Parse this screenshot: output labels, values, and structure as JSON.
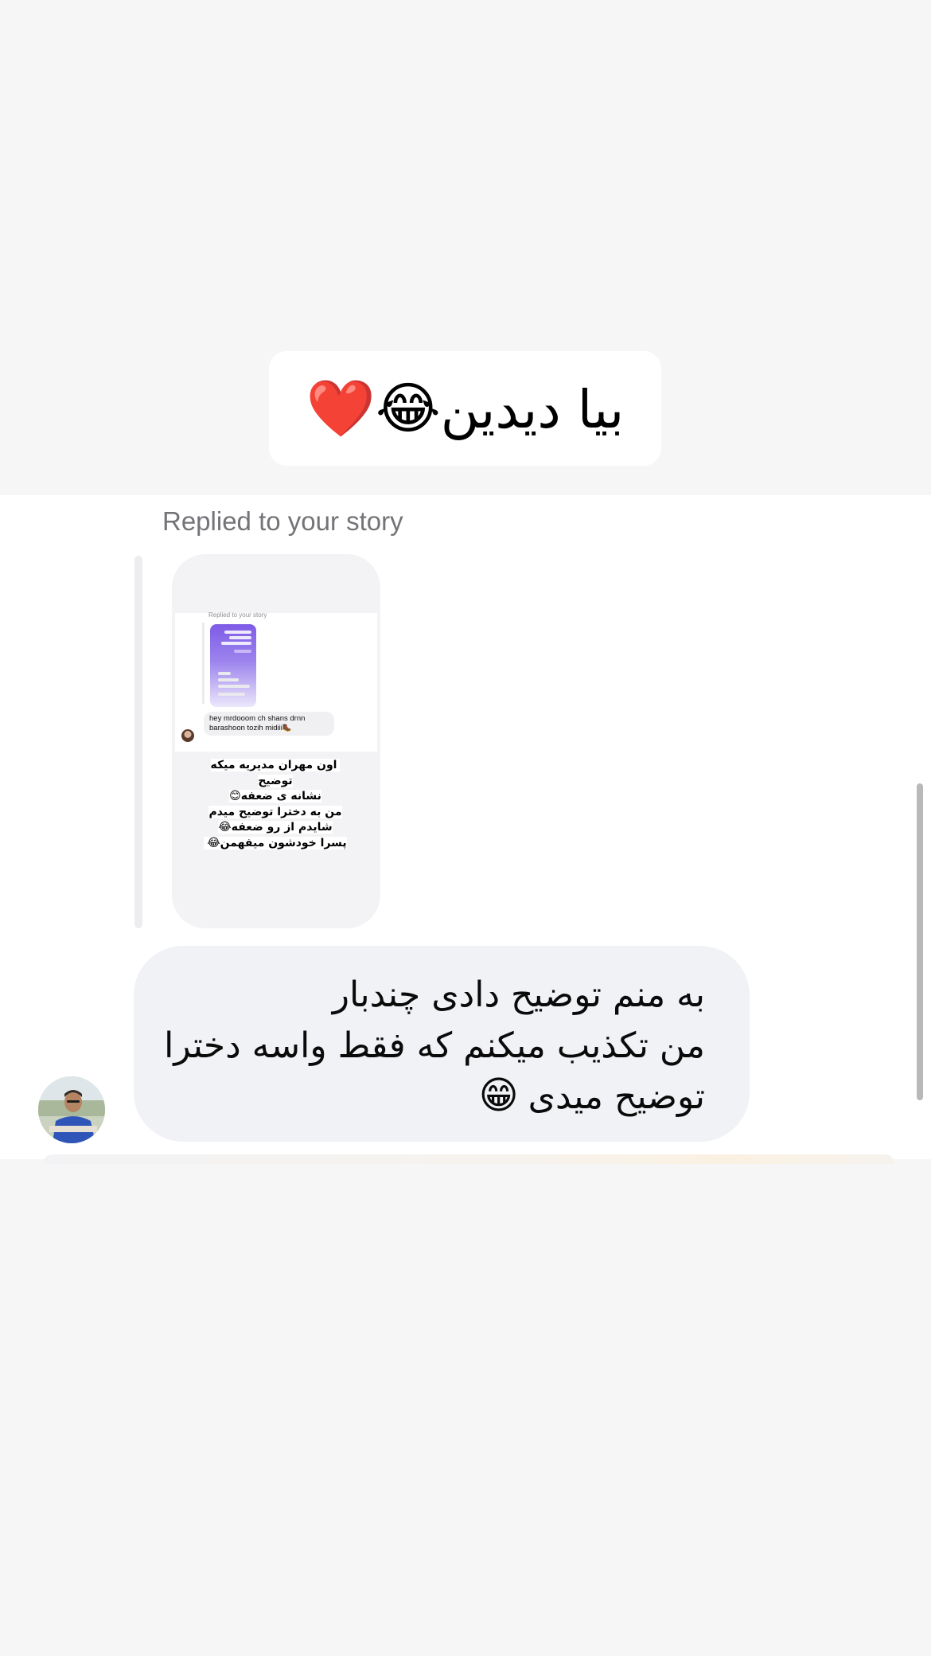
{
  "story_caption": {
    "text": "بیا دیدین",
    "emojis": [
      "😂",
      "❤️"
    ]
  },
  "conversation": {
    "replied_label": "Replied to your story",
    "story_preview": {
      "inner_replied_label": "Replied to your story",
      "inner_message": "hey mrdooom ch shans drnn\nbarashoon tozih midiii🥾",
      "overlay_text": "اون مهران مدیریه میکه توضیح\nنشانه ی ضعفه😊\nمن به دخترا توضیح میدم\nشایدم از رو ضعفه😂\nپسرا خودشون میفهمن😂"
    },
    "message": {
      "lines": [
        "به منم توضیح دادی چندبار",
        "من تکذیب میکنم که فقط واسه دخترا",
        "توضیح میدی"
      ],
      "emoji": "😁"
    },
    "sender": {
      "avatar_icon": "profile-photo"
    }
  }
}
